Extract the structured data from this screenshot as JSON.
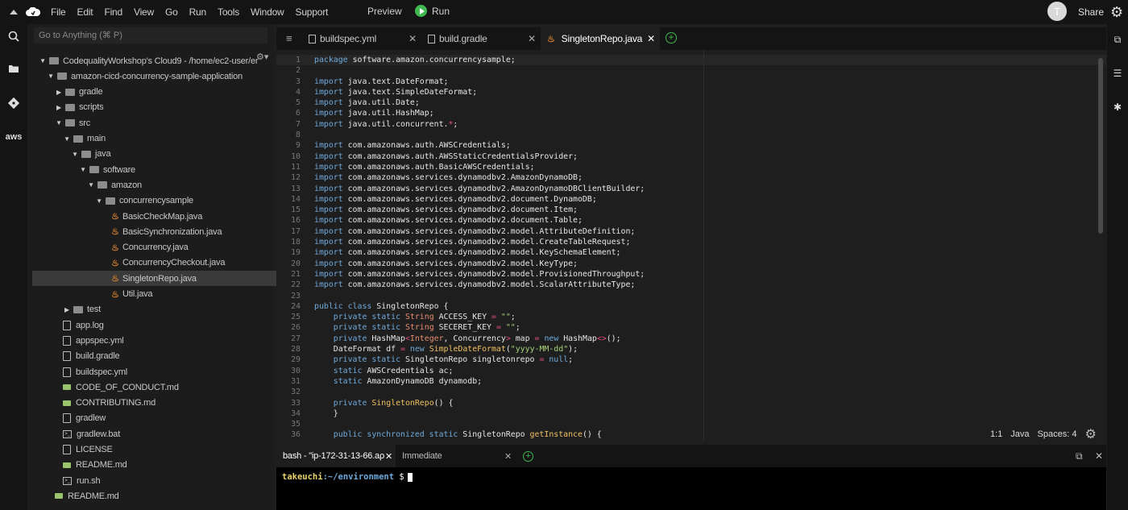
{
  "menubar": {
    "items": [
      "File",
      "Edit",
      "Find",
      "View",
      "Go",
      "Run",
      "Tools",
      "Window",
      "Support"
    ],
    "preview": "Preview",
    "run": "Run",
    "avatar_letter": "T",
    "share": "Share"
  },
  "search": {
    "placeholder": "Go to Anything (⌘ P)"
  },
  "leftbar": {
    "aws": "aws"
  },
  "tree": [
    {
      "label": "CodequalityWorkshop's Cloud9 - /home/ec2-user/er",
      "indent": 0,
      "kind": "folder",
      "open": true
    },
    {
      "label": "amazon-cicd-concurrency-sample-application",
      "indent": 1,
      "kind": "folder",
      "open": true
    },
    {
      "label": "gradle",
      "indent": 2,
      "kind": "folder",
      "open": false
    },
    {
      "label": "scripts",
      "indent": 2,
      "kind": "folder",
      "open": false
    },
    {
      "label": "src",
      "indent": 2,
      "kind": "folder",
      "open": true
    },
    {
      "label": "main",
      "indent": 3,
      "kind": "folder",
      "open": true
    },
    {
      "label": "java",
      "indent": 4,
      "kind": "folder",
      "open": true
    },
    {
      "label": "software",
      "indent": 5,
      "kind": "folder",
      "open": true
    },
    {
      "label": "amazon",
      "indent": 6,
      "kind": "folder",
      "open": true
    },
    {
      "label": "concurrencysample",
      "indent": 7,
      "kind": "folder",
      "open": true
    },
    {
      "label": "BasicCheckMap.java",
      "indent": 9,
      "kind": "java"
    },
    {
      "label": "BasicSynchronization.java",
      "indent": 9,
      "kind": "java"
    },
    {
      "label": "Concurrency.java",
      "indent": 9,
      "kind": "java"
    },
    {
      "label": "ConcurrencyCheckout.java",
      "indent": 9,
      "kind": "java"
    },
    {
      "label": "SingletonRepo.java",
      "indent": 9,
      "kind": "java",
      "selected": true
    },
    {
      "label": "Util.java",
      "indent": 9,
      "kind": "java"
    },
    {
      "label": "test",
      "indent": 3,
      "kind": "folder",
      "open": false
    },
    {
      "label": "app.log",
      "indent": 3,
      "kind": "file"
    },
    {
      "label": "appspec.yml",
      "indent": 3,
      "kind": "file"
    },
    {
      "label": "build.gradle",
      "indent": 3,
      "kind": "file"
    },
    {
      "label": "buildspec.yml",
      "indent": 3,
      "kind": "file"
    },
    {
      "label": "CODE_OF_CONDUCT.md",
      "indent": 3,
      "kind": "md"
    },
    {
      "label": "CONTRIBUTING.md",
      "indent": 3,
      "kind": "md"
    },
    {
      "label": "gradlew",
      "indent": 3,
      "kind": "file"
    },
    {
      "label": "gradlew.bat",
      "indent": 3,
      "kind": "term"
    },
    {
      "label": "LICENSE",
      "indent": 3,
      "kind": "file"
    },
    {
      "label": "README.md",
      "indent": 3,
      "kind": "md"
    },
    {
      "label": "run.sh",
      "indent": 3,
      "kind": "term"
    },
    {
      "label": "README.md",
      "indent": 2,
      "kind": "md"
    }
  ],
  "tabs": [
    {
      "label": "buildspec.yml",
      "kind": "file",
      "active": false
    },
    {
      "label": "build.gradle",
      "kind": "file",
      "active": false
    },
    {
      "label": "SingletonRepo.java",
      "kind": "java",
      "active": true
    }
  ],
  "code_lines": [
    "<span class='k'>package</span> software.amazon.concurrencysample;",
    "",
    "<span class='k'>import</span> java.text.DateFormat;",
    "<span class='k'>import</span> java.text.SimpleDateFormat;",
    "<span class='k'>import</span> java.util.Date;",
    "<span class='k'>import</span> java.util.HashMap;",
    "<span class='k'>import</span> java.util.concurrent.<span class='o'>*</span>;",
    "",
    "<span class='k'>import</span> com.amazonaws.auth.AWSCredentials;",
    "<span class='k'>import</span> com.amazonaws.auth.AWSStaticCredentialsProvider;",
    "<span class='k'>import</span> com.amazonaws.auth.BasicAWSCredentials;",
    "<span class='k'>import</span> com.amazonaws.services.dynamodbv2.AmazonDynamoDB;",
    "<span class='k'>import</span> com.amazonaws.services.dynamodbv2.AmazonDynamoDBClientBuilder;",
    "<span class='k'>import</span> com.amazonaws.services.dynamodbv2.document.DynamoDB;",
    "<span class='k'>import</span> com.amazonaws.services.dynamodbv2.document.Item;",
    "<span class='k'>import</span> com.amazonaws.services.dynamodbv2.document.Table;",
    "<span class='k'>import</span> com.amazonaws.services.dynamodbv2.model.AttributeDefinition;",
    "<span class='k'>import</span> com.amazonaws.services.dynamodbv2.model.CreateTableRequest;",
    "<span class='k'>import</span> com.amazonaws.services.dynamodbv2.model.KeySchemaElement;",
    "<span class='k'>import</span> com.amazonaws.services.dynamodbv2.model.KeyType;",
    "<span class='k'>import</span> com.amazonaws.services.dynamodbv2.model.ProvisionedThroughput;",
    "<span class='k'>import</span> com.amazonaws.services.dynamodbv2.model.ScalarAttributeType;",
    "",
    "<span class='k'>public class</span> SingletonRepo {",
    "    <span class='k'>private static</span> <span class='t'>String</span> ACCESS_KEY <span class='o'>=</span> <span class='s'>\"\"</span>;",
    "    <span class='k'>private static</span> <span class='t'>String</span> SECERET_KEY <span class='o'>=</span> <span class='s'>\"\"</span>;",
    "    <span class='k'>private</span> HashMap<span class='o'>&lt;</span><span class='t'>Integer</span>, Concurrency<span class='o'>&gt;</span> map <span class='o'>=</span> <span class='k'>new</span> HashMap<span class='o'>&lt;&gt;</span>();",
    "    DateFormat df <span class='o'>=</span> <span class='k'>new</span> <span class='f'>SimpleDateFormat</span>(<span class='s'>\"yyyy-MM-dd\"</span>);",
    "    <span class='k'>private static</span> SingletonRepo singletonrepo <span class='o'>=</span> <span class='k'>null</span>;",
    "    <span class='k'>static</span> AWSCredentials ac;",
    "    <span class='k'>static</span> AmazonDynamoDB dynamodb;",
    "",
    "    <span class='k'>private</span> <span class='f'>SingletonRepo</span>() {",
    "    }",
    "",
    "    <span class='k'>public synchronized static</span> SingletonRepo <span class='f'>getInstance</span>() {"
  ],
  "status": {
    "position": "1:1",
    "language": "Java",
    "spaces": "Spaces: 4"
  },
  "terminal": {
    "tabs": [
      {
        "label": "bash - \"ip-172-31-13-66.aρ",
        "active": true
      },
      {
        "label": "Immediate",
        "active": false
      }
    ],
    "prompt_user": "takeuchi",
    "prompt_path": ":~/environment",
    "prompt_sign": " $"
  }
}
